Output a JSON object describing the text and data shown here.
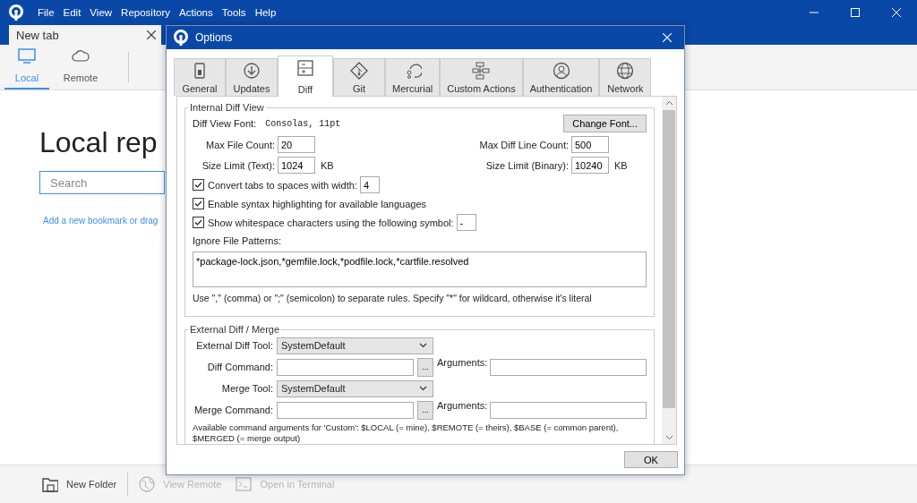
{
  "menu": [
    "File",
    "Edit",
    "View",
    "Repository",
    "Actions",
    "Tools",
    "Help"
  ],
  "tabs": [
    {
      "label": "New tab",
      "selected": true
    }
  ],
  "toolbar": [
    {
      "label": "Local",
      "selected": true
    },
    {
      "label": "Remote",
      "selected": false
    }
  ],
  "page": {
    "title": "Local rep",
    "search": {
      "placeholder": "Search"
    },
    "link": "Add a new bookmark or drag"
  },
  "bottom_bar": [
    {
      "label": "New Folder",
      "disabled": false
    },
    {
      "label": "View Remote",
      "disabled": true
    },
    {
      "label": "Open in Terminal",
      "disabled": true
    }
  ],
  "dialog": {
    "title": "Options",
    "tabs": [
      {
        "label": "General",
        "selected": false
      },
      {
        "label": "Updates",
        "selected": false
      },
      {
        "label": "Diff",
        "selected": true
      },
      {
        "label": "Git",
        "selected": false
      },
      {
        "label": "Mercurial",
        "selected": false
      },
      {
        "label": "Custom Actions",
        "selected": false
      },
      {
        "label": "Authentication",
        "selected": false
      },
      {
        "label": "Network",
        "selected": false
      }
    ],
    "internal": {
      "title": "Internal Diff View",
      "font_label": "Diff View Font:",
      "font_value": "Consolas, 11pt",
      "font_button": "Change Font...",
      "field_rows": [
        [
          {
            "label": "Max File Count:",
            "value": "20"
          },
          {
            "label": "Max Diff Line Count:",
            "value": "500"
          }
        ],
        [
          {
            "label": "Size Limit (Text):",
            "value": "1024",
            "unit": "KB"
          },
          {
            "label": "Size Limit (Binary):",
            "value": "10240",
            "unit": "KB"
          }
        ]
      ],
      "checkboxes": [
        {
          "label": "Convert tabs to spaces with width:",
          "checked": true,
          "value": "4"
        },
        {
          "label": "Enable syntax highlighting for available languages",
          "checked": true
        },
        {
          "label": "Show whitespace characters using the following symbol:",
          "checked": true,
          "value": "-"
        }
      ],
      "ignore_label": "Ignore File Patterns:",
      "ignore_value": "*package-lock.json,*gemfile.lock,*podfile.lock,*cartfile.resolved",
      "hint": "Use \",\" (comma) or \";\" (semicolon) to separate rules. Specify \"*\" for wildcard, otherwise it's literal"
    },
    "external": {
      "title": "External Diff / Merge",
      "rows": [
        {
          "kind": "select",
          "label": "External Diff Tool:",
          "value": "SystemDefault"
        },
        {
          "kind": "command",
          "label": "Diff Command:",
          "browse": "...",
          "args_label": "Arguments:"
        },
        {
          "kind": "select",
          "label": "Merge Tool:",
          "value": "SystemDefault"
        },
        {
          "kind": "command",
          "label": "Merge Command:",
          "browse": "...",
          "args_label": "Arguments:"
        }
      ],
      "note": "Available command arguments for 'Custom': $LOCAL (= mine), $REMOTE (= theirs), $BASE (= common parent), $MERGED (= merge output)"
    },
    "ok": "OK"
  }
}
